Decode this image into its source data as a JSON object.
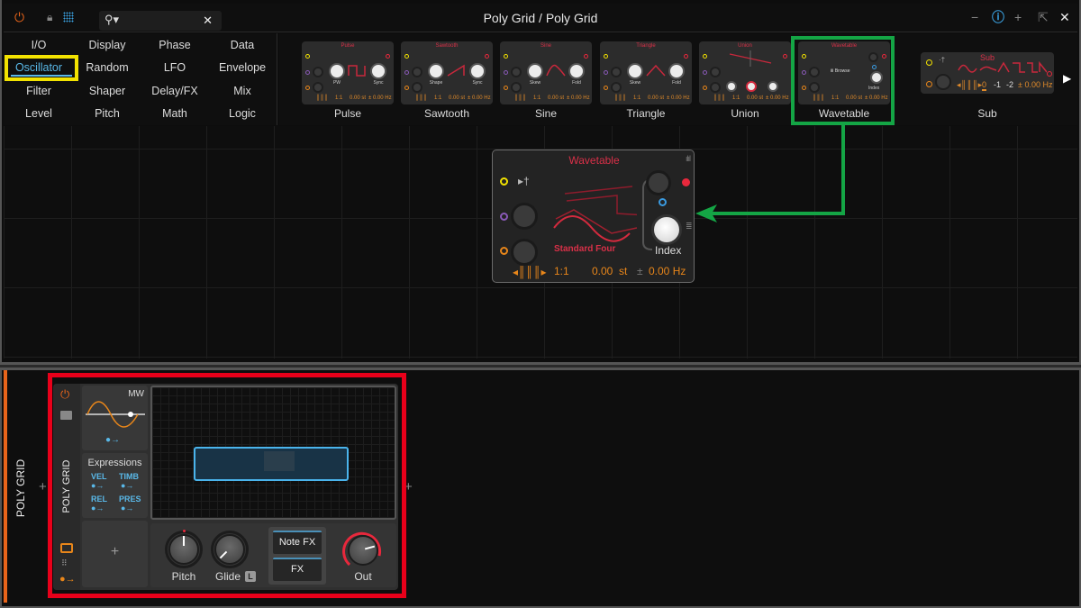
{
  "window": {
    "title": "Poly Grid / Poly Grid"
  },
  "toolbar": {
    "power_icon": "power-icon",
    "lock_icon": "lock-icon",
    "grid_icon": "grid-icon",
    "search_placeholder": "",
    "clear_label": "✕"
  },
  "window_controls": {
    "minus": "−",
    "zoom": "ⓘ",
    "plus": "+",
    "popout": "⇱",
    "close": "✕"
  },
  "categories": [
    [
      "I/O",
      "Display",
      "Phase",
      "Data"
    ],
    [
      "Oscillator",
      "Random",
      "LFO",
      "Envelope"
    ],
    [
      "Filter",
      "Shaper",
      "Delay/FX",
      "Mix"
    ],
    [
      "Level",
      "Pitch",
      "Math",
      "Logic"
    ]
  ],
  "selected_category": "Oscillator",
  "presets": [
    {
      "title": "Pulse",
      "label": "Pulse",
      "k1": "PW",
      "k2": "Sync",
      "ratio": "1:1",
      "st": "0.00 st",
      "hz": "± 0.00 Hz"
    },
    {
      "title": "Sawtooth",
      "label": "Sawtooth",
      "k1": "Shape",
      "k2": "Sync",
      "ratio": "1:1",
      "st": "0.00 st",
      "hz": "± 0.00 Hz"
    },
    {
      "title": "Sine",
      "label": "Sine",
      "k1": "Skew",
      "k2": "Fold",
      "ratio": "1:1",
      "st": "0.00 st",
      "hz": "± 0.00 Hz"
    },
    {
      "title": "Triangle",
      "label": "Triangle",
      "k1": "Skew",
      "k2": "Fold",
      "ratio": "1:1",
      "st": "0.00 st",
      "hz": "± 0.00 Hz"
    },
    {
      "title": "Union",
      "label": "Union",
      "k1": "",
      "k2": "",
      "ratio": "1:1",
      "st": "0.00 st",
      "hz": "± 0.00 Hz"
    },
    {
      "title": "Wavetable",
      "label": "Wavetable",
      "k1": "Browse",
      "k2": "Index",
      "ratio": "1:1",
      "st": "0.00 st",
      "hz": "± 0.00 Hz"
    }
  ],
  "sub": {
    "title": "Sub",
    "label": "Sub",
    "octaves": [
      "0",
      "-1",
      "-2"
    ],
    "hz": "± 0.00 Hz"
  },
  "scroll_right": "▶",
  "wavetable_module": {
    "title": "Wavetable",
    "table_name": "Standard Four",
    "index_label": "Index",
    "ratio": "1:1",
    "st_value": "0.00",
    "st_unit": "st",
    "hz": "0.00 Hz",
    "hz_prefix": "±"
  },
  "device": {
    "track_label": "POLY GRID",
    "device_label": "POLY GRID",
    "add_left": "+",
    "add_right": "+",
    "mw_label": "MW",
    "expressions_title": "Expressions",
    "expressions": [
      "VEL",
      "TIMB",
      "REL",
      "PRES"
    ],
    "add_module": "+",
    "pitch_label": "Pitch",
    "glide_label": "Glide",
    "glide_badge": "L",
    "note_fx": "Note FX",
    "fx": "FX",
    "out_label": "Out"
  },
  "annotation_colors": {
    "yellow": "#f2e200",
    "green": "#14a545",
    "red": "#e8001a"
  }
}
